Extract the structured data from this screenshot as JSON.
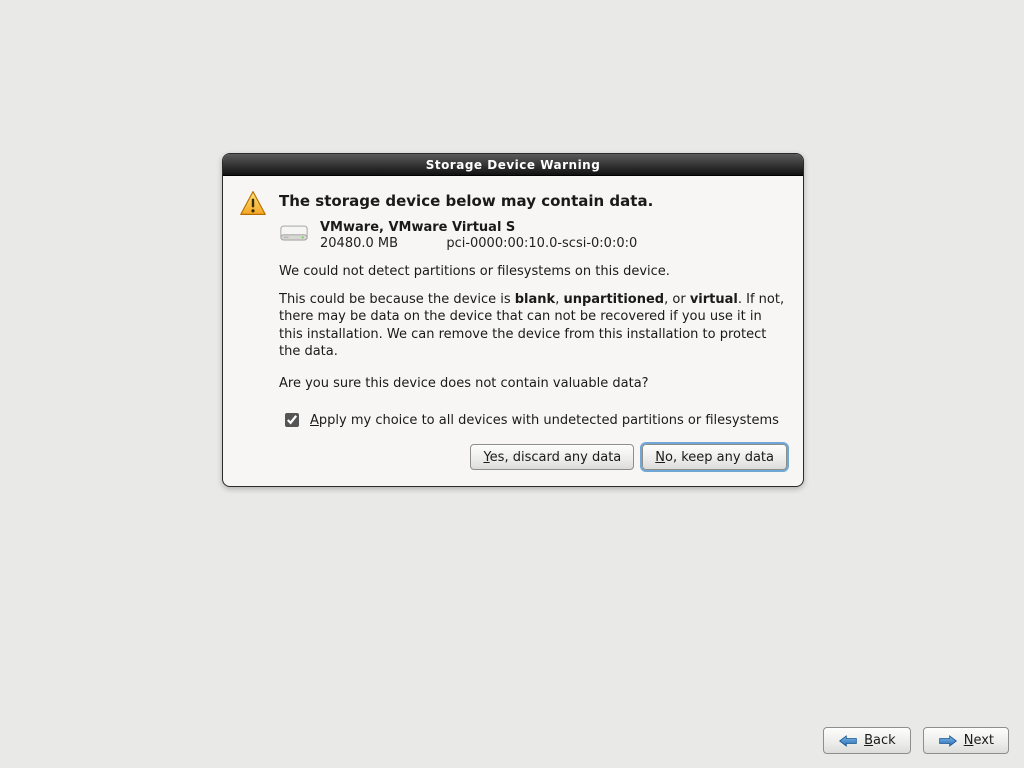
{
  "dialog": {
    "title": "Storage Device Warning",
    "heading": "The storage device below may contain data.",
    "device": {
      "name": "VMware, VMware Virtual S",
      "size": "20480.0 MB",
      "path": "pci-0000:00:10.0-scsi-0:0:0:0"
    },
    "para_detect": "We could not detect partitions or filesystems on this device.",
    "para_reason_pre": "This could be because the device is ",
    "bold_blank": "blank",
    "comma1": ", ",
    "bold_unpart": "unpartitioned",
    "comma2": ", or ",
    "bold_virtual": "virtual",
    "para_reason_post": ". If not, there may be data on the device that can not be recovered if you use it in this installation. We can remove the device from this installation to protect the data.",
    "para_confirm": "Are you sure this device does not contain valuable data?",
    "checkbox": {
      "checked": true,
      "mnemonic": "A",
      "rest": "pply my choice to all devices with undetected partitions or filesystems"
    },
    "buttons": {
      "yes_mnemonic": "Y",
      "yes_rest": "es, discard any data",
      "no_mnemonic": "N",
      "no_rest": "o, keep any data"
    }
  },
  "nav": {
    "back_mnemonic": "B",
    "back_rest": "ack",
    "next_mnemonic": "N",
    "next_rest": "ext"
  }
}
